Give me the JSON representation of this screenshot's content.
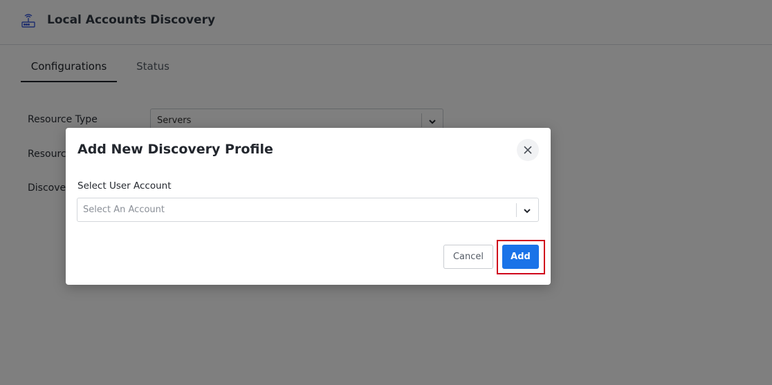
{
  "header": {
    "title": "Local Accounts Discovery",
    "icon": "router-icon"
  },
  "tabs": [
    {
      "label": "Configurations",
      "active": true
    },
    {
      "label": "Status",
      "active": false
    }
  ],
  "form": {
    "resource_type_label": "Resource Type",
    "resource_type_value": "Servers",
    "resource_label_partial": "Resource",
    "discovery_label_partial": "Discover"
  },
  "modal": {
    "title": "Add New Discovery Profile",
    "field_label": "Select User Account",
    "account_placeholder": "Select An Account",
    "cancel_label": "Cancel",
    "add_label": "Add"
  },
  "colors": {
    "primary": "#1a73e8",
    "highlight": "#d0021b"
  }
}
